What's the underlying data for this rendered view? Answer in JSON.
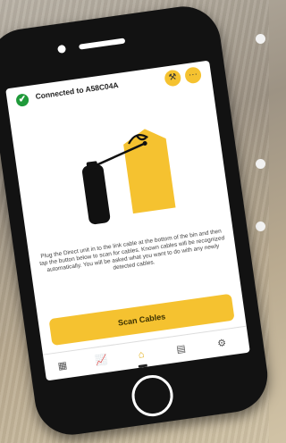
{
  "status": {
    "connected_label": "Connected to A58C04A",
    "check_icon": "✔"
  },
  "header": {
    "tools_icon": "⚒",
    "more_icon": "···"
  },
  "instructions": {
    "text": "Plug the Direct unit in to the link cable at the bottom of the bin and then tap the button below to scan for cables. Known cables will be recognized automatically. You will be asked what you want to do with any newly detected cables."
  },
  "actions": {
    "scan_label": "Scan Cables"
  },
  "nav": {
    "items": [
      {
        "name": "grid",
        "glyph": "▦"
      },
      {
        "name": "chart",
        "glyph": "📈"
      },
      {
        "name": "bin",
        "glyph": "⌂"
      },
      {
        "name": "document",
        "glyph": "▤"
      },
      {
        "name": "settings",
        "glyph": "⚙"
      }
    ],
    "active": "bin"
  },
  "colors": {
    "accent": "#f5c230",
    "success": "#1f9a3a"
  }
}
